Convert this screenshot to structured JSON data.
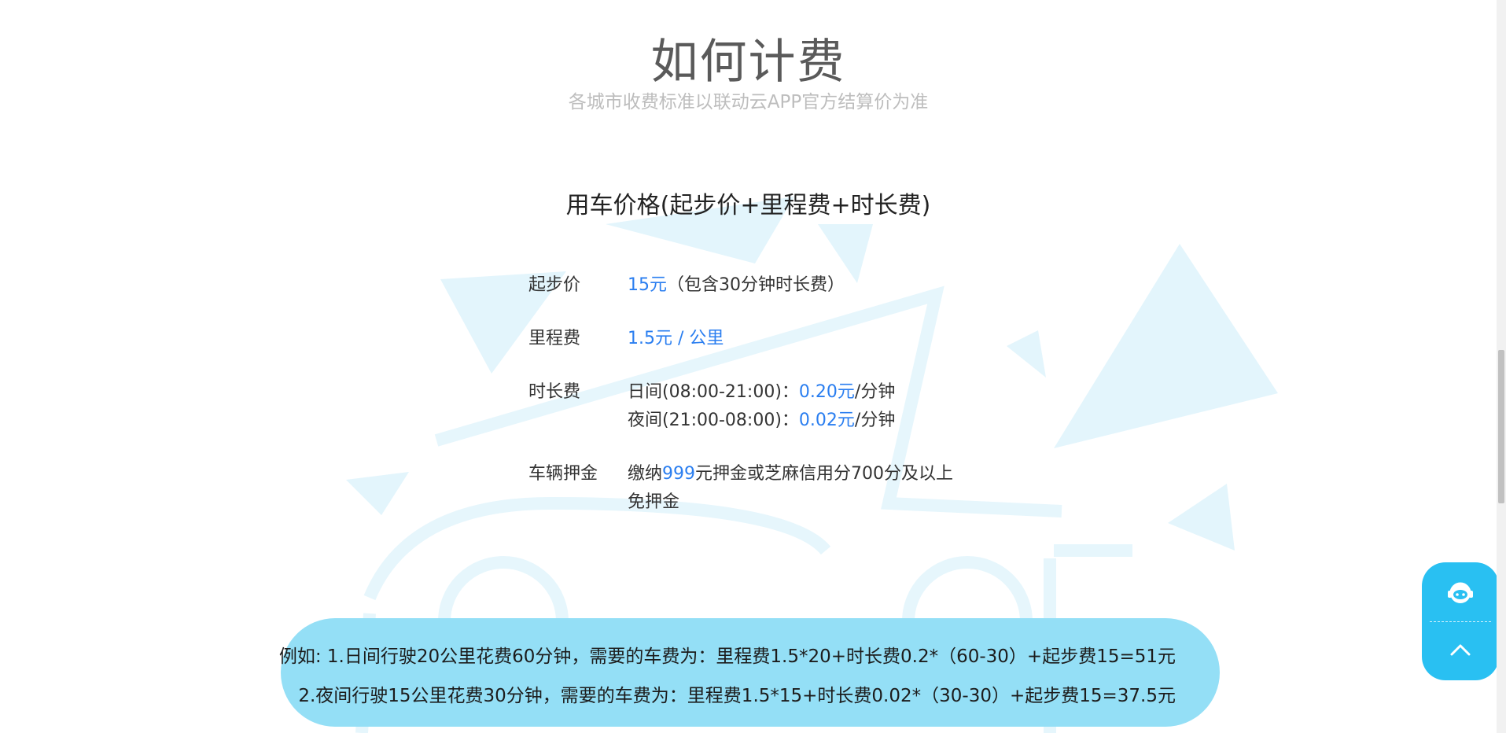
{
  "header": {
    "title": "如何计费",
    "subtitle": "各城市收费标准以联动云APP官方结算价为准"
  },
  "pricing": {
    "section_title": "用车价格(起步价+里程费+时长费)",
    "start_price": {
      "label": "起步价",
      "amount": "15元",
      "note": "（包含30分钟时长费）"
    },
    "mileage": {
      "label": "里程费",
      "amount": "1.5元 / 公里"
    },
    "duration": {
      "label": "时长费",
      "day_prefix": "日间(08:00-21:00)：",
      "day_rate": "0.20元",
      "night_prefix": "夜间(21:00-08:00)：",
      "night_rate": "0.02元",
      "unit": "/分钟"
    },
    "deposit": {
      "label": "车辆押金",
      "prefix": "缴纳",
      "amount": "999",
      "suffix": "元押金或芝麻信用分700分及以上",
      "line2": "免押金"
    }
  },
  "example": {
    "line1": "例如: 1.日间行驶20公里花费60分钟，需要的车费为：里程费1.5*20+时长费0.2*（60-30）+起步费15=51元",
    "line2": "2.夜间行驶15公里花费30分钟，需要的车费为：里程费1.5*15+时长费0.02*（30-30）+起步费15=37.5元"
  },
  "float_widget": {
    "service_icon": "customer-service-icon",
    "top_icon": "chevron-up-icon"
  },
  "colors": {
    "accent_blue": "#2a7ef0",
    "example_bg": "#94dff6",
    "widget_bg": "#29c0f2",
    "art_tint": "#dff3fb"
  }
}
